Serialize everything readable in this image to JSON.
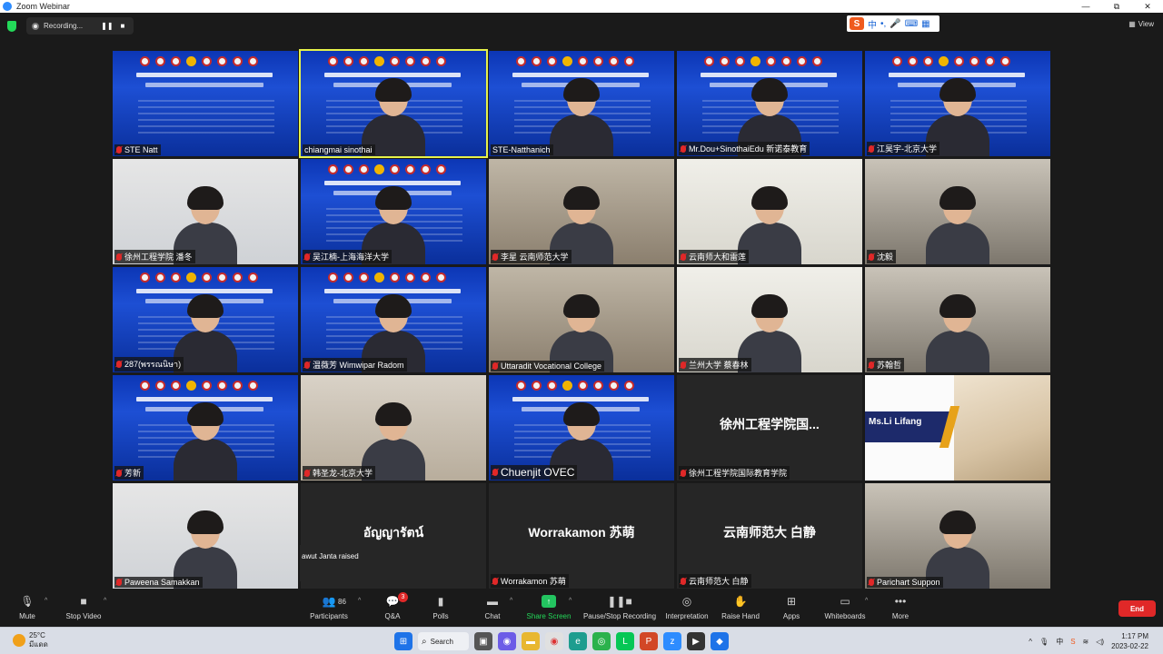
{
  "window": {
    "title": "Zoom Webinar",
    "controls": [
      "—",
      "⧉",
      "✕"
    ]
  },
  "meeting_bar": {
    "recording_label": "Recording...",
    "pause_glyph": "❚❚",
    "stop_glyph": "■",
    "view_label": "View",
    "ime": {
      "logo": "S",
      "items": [
        "中",
        "•,",
        "🎤",
        "⌨",
        "▦"
      ]
    }
  },
  "tiles": [
    {
      "name": "STE Natt",
      "type": "banner"
    },
    {
      "name": "chiangmai sinothai",
      "type": "banner-person",
      "selected": true
    },
    {
      "name": "STE-Natthanich",
      "type": "banner-person"
    },
    {
      "name": "Mr.Dou+SinothaiEdu 新诺泰教育",
      "type": "banner-person"
    },
    {
      "name": "江昊宇-北京大学",
      "type": "banner-person"
    },
    {
      "name": "徐州工程学院 潘冬",
      "type": "room"
    },
    {
      "name": "吴江楠-上海海洋大学",
      "type": "banner-person"
    },
    {
      "name": "李星 云南师范大学",
      "type": "room"
    },
    {
      "name": "云南师大和雷莲",
      "type": "room"
    },
    {
      "name": "沈毅",
      "type": "room"
    },
    {
      "name": "287(พรรณนิษา)",
      "type": "banner-person"
    },
    {
      "name": "温薇芳 Wimwipar Radom",
      "type": "banner-person"
    },
    {
      "name": "Uttaradit Vocational College",
      "type": "room"
    },
    {
      "name": "兰州大学 蔡春林",
      "type": "room"
    },
    {
      "name": "苏翰哲",
      "type": "room"
    },
    {
      "name": "芳新",
      "type": "banner-person"
    },
    {
      "name": "韩圣龙-北京大学",
      "type": "room"
    },
    {
      "name": "Chuenjit OVEC",
      "type": "banner-person",
      "big": true
    },
    {
      "name": "徐州工程学院国际教育学院",
      "type": "text",
      "center_text": "徐州工程学院国..."
    },
    {
      "name": "",
      "type": "ms-card",
      "card_name": "Ms.Li Lifang"
    },
    {
      "name": "Paweena Samakkan",
      "type": "room"
    },
    {
      "name": "",
      "type": "text",
      "center_text": "อัญญารัตน์"
    },
    {
      "name": "Worrakamon 苏萌",
      "type": "text",
      "center_text": "Worrakamon 苏萌"
    },
    {
      "name": "云南师范大 白静",
      "type": "text",
      "center_text": "云南师范大 白静"
    },
    {
      "name": "Parichart Suppon",
      "type": "room"
    }
  ],
  "raised_notice": "awut Janta raised",
  "toolbar": {
    "mute_label": "Mute",
    "stop_video_label": "Stop Video",
    "participants_label": "Participants",
    "participants_count": "86",
    "qa_label": "Q&A",
    "qa_badge": "3",
    "polls_label": "Polls",
    "chat_label": "Chat",
    "share_label": "Share Screen",
    "recording_label": "Pause/Stop Recording",
    "interpretation_label": "Interpretation",
    "raise_hand_label": "Raise Hand",
    "apps_label": "Apps",
    "whiteboards_label": "Whiteboards",
    "more_label": "More",
    "end_label": "End"
  },
  "taskbar": {
    "temperature": "25°C",
    "weather_text": "มีแดด",
    "search_label": "Search",
    "lang": "中",
    "time": "1:17 PM",
    "date": "2023-02-22"
  },
  "colors": {
    "accent_green": "#23d959",
    "end_red": "#e02828",
    "banner_blue": "#0c36b5"
  }
}
